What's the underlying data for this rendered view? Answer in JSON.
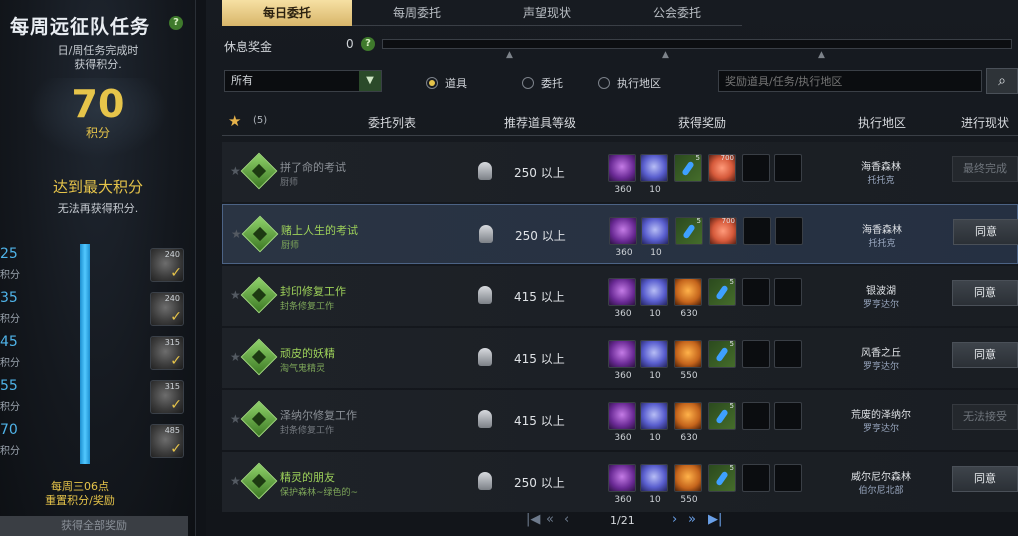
{
  "left_panel": {
    "title": "每周远征队任务",
    "subtitle_line1": "日/周任务完成时",
    "subtitle_line2": "获得积分.",
    "score": "70",
    "score_label": "积分",
    "max_text": "达到最大积分",
    "no_more_text": "无法再获得积分.",
    "progress_fraction": 1.0,
    "tiers": [
      {
        "num": "25",
        "label": "积分",
        "reward": "240"
      },
      {
        "num": "35",
        "label": "积分",
        "reward": "240"
      },
      {
        "num": "45",
        "label": "积分",
        "reward": "315"
      },
      {
        "num": "55",
        "label": "积分",
        "reward": "315"
      },
      {
        "num": "70",
        "label": "积分",
        "reward": "485"
      }
    ],
    "reset_line1": "每周三06点",
    "reset_line2": "重置积分/奖励",
    "claim_all": "获得全部奖励"
  },
  "tabs": [
    "每日委托",
    "每周委托",
    "声望现状",
    "公会委托"
  ],
  "rest_bonus": {
    "label": "休息奖金",
    "value": "0"
  },
  "filter": {
    "select_value": "所有",
    "radios": [
      "道具",
      "委托",
      "执行地区"
    ],
    "selected_radio": 0,
    "search_placeholder": "奖励道具/任务/执行地区"
  },
  "table": {
    "star_count": "(5)",
    "headers": [
      "委托列表",
      "推荐道具等级",
      "获得奖励",
      "执行地区",
      "进行现状"
    ],
    "rows": [
      {
        "name": "拼了命的考试",
        "npc": "厨师",
        "level": "250 以上",
        "rewards": [
          {
            "type": "purple",
            "count": "360"
          },
          {
            "type": "gem",
            "count": "10"
          },
          {
            "type": "potion",
            "sup": "5"
          },
          {
            "type": "heart",
            "sup": "700"
          },
          {
            "type": "empty"
          },
          {
            "type": "empty"
          }
        ],
        "region": "海香森林",
        "region_sub": "托托克",
        "action": "最终完成",
        "action_disabled": true,
        "dim": true
      },
      {
        "name": "赌上人生的考试",
        "npc": "厨师",
        "level": "250 以上",
        "rewards": [
          {
            "type": "purple",
            "count": "360"
          },
          {
            "type": "gem",
            "count": "10"
          },
          {
            "type": "potion",
            "sup": "5"
          },
          {
            "type": "heart",
            "sup": "700"
          },
          {
            "type": "empty"
          },
          {
            "type": "empty"
          }
        ],
        "region": "海香森林",
        "region_sub": "托托克",
        "action": "同意",
        "action_disabled": false,
        "dim": false,
        "selected": true
      },
      {
        "name": "封印修复工作",
        "npc": "封条修复工作",
        "level": "415 以上",
        "rewards": [
          {
            "type": "purple",
            "count": "360"
          },
          {
            "type": "gem",
            "count": "10"
          },
          {
            "type": "amber",
            "count": "630"
          },
          {
            "type": "potion",
            "sup": "5"
          },
          {
            "type": "empty"
          },
          {
            "type": "empty"
          }
        ],
        "region": "银波湖",
        "region_sub": "罗亨达尔",
        "action": "同意",
        "action_disabled": false,
        "dim": false
      },
      {
        "name": "顽皮的妖精",
        "npc": "淘气鬼精灵",
        "level": "415 以上",
        "rewards": [
          {
            "type": "purple",
            "count": "360"
          },
          {
            "type": "gem",
            "count": "10"
          },
          {
            "type": "amber",
            "count": "550"
          },
          {
            "type": "potion",
            "sup": "5"
          },
          {
            "type": "empty"
          },
          {
            "type": "empty"
          }
        ],
        "region": "风香之丘",
        "region_sub": "罗亨达尔",
        "action": "同意",
        "action_disabled": false,
        "dim": false
      },
      {
        "name": "泽纳尔修复工作",
        "npc": "封条修复工作",
        "level": "415 以上",
        "rewards": [
          {
            "type": "purple",
            "count": "360"
          },
          {
            "type": "gem",
            "count": "10"
          },
          {
            "type": "amber",
            "count": "630"
          },
          {
            "type": "potion",
            "sup": "5"
          },
          {
            "type": "empty"
          },
          {
            "type": "empty"
          }
        ],
        "region": "荒废的泽纳尔",
        "region_sub": "罗亨达尔",
        "action": "无法接受",
        "action_disabled": true,
        "dim": true
      },
      {
        "name": "精灵的朋友",
        "npc": "保护森林~绿色的~",
        "level": "250 以上",
        "rewards": [
          {
            "type": "purple",
            "count": "360"
          },
          {
            "type": "gem",
            "count": "10"
          },
          {
            "type": "amber",
            "count": "550"
          },
          {
            "type": "potion",
            "sup": "5"
          },
          {
            "type": "empty"
          },
          {
            "type": "empty"
          }
        ],
        "region": "威尔尼尔森林",
        "region_sub": "伯尔尼北部",
        "action": "同意",
        "action_disabled": false,
        "dim": false
      }
    ]
  },
  "pager": {
    "label": "1/21"
  }
}
